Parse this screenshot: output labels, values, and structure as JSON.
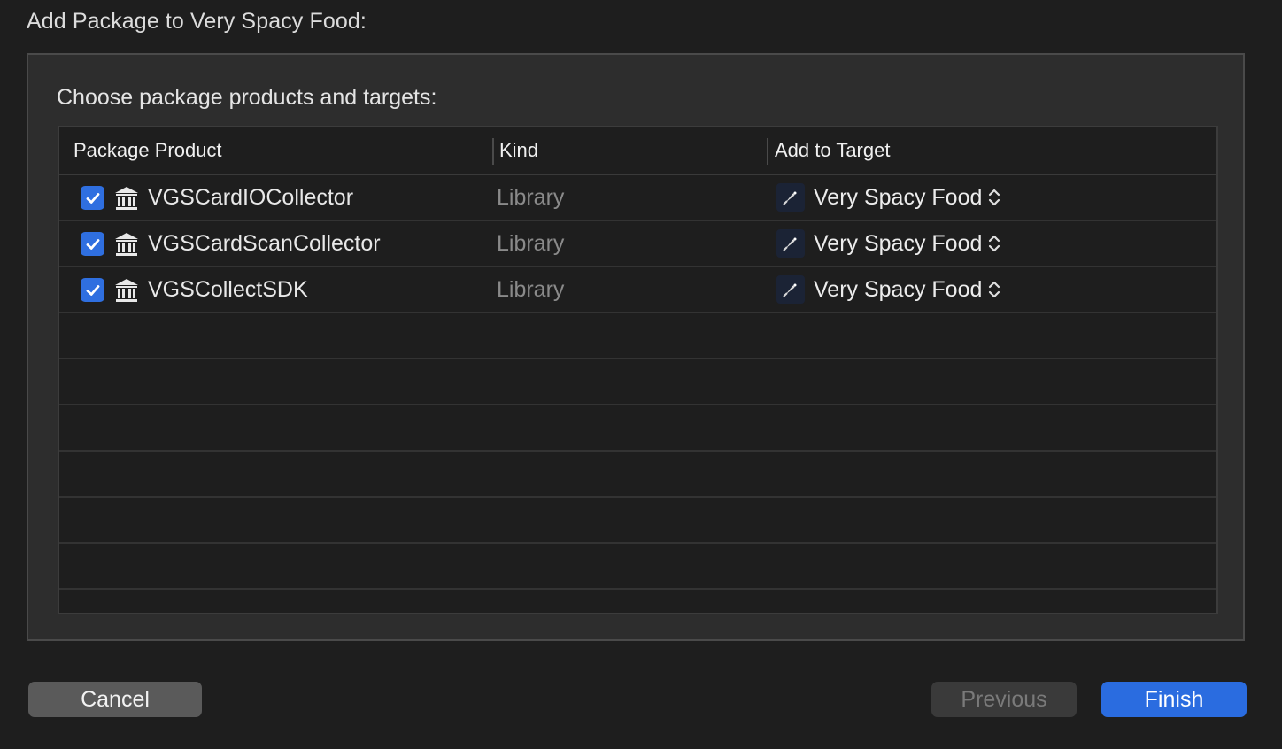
{
  "dialog": {
    "title": "Add Package to Very Spacy Food:",
    "heading": "Choose package products and targets:"
  },
  "table": {
    "columns": {
      "product": "Package Product",
      "kind": "Kind",
      "target": "Add to Target"
    },
    "rows": [
      {
        "checked": true,
        "product": "VGSCardIOCollector",
        "kind": "Library",
        "target": "Very Spacy Food"
      },
      {
        "checked": true,
        "product": "VGSCardScanCollector",
        "kind": "Library",
        "target": "Very Spacy Food"
      },
      {
        "checked": true,
        "product": "VGSCollectSDK",
        "kind": "Library",
        "target": "Very Spacy Food"
      }
    ]
  },
  "buttons": {
    "cancel": "Cancel",
    "previous": "Previous",
    "finish": "Finish"
  },
  "icons": {
    "checkbox": "checkmark-icon",
    "product": "library-building-icon",
    "target": "app-target-icon",
    "popup": "up-down-chevron-icon"
  },
  "colors": {
    "accent": "#2a6ce0",
    "background": "#1e1e1e",
    "panel": "#2d2d2d"
  }
}
